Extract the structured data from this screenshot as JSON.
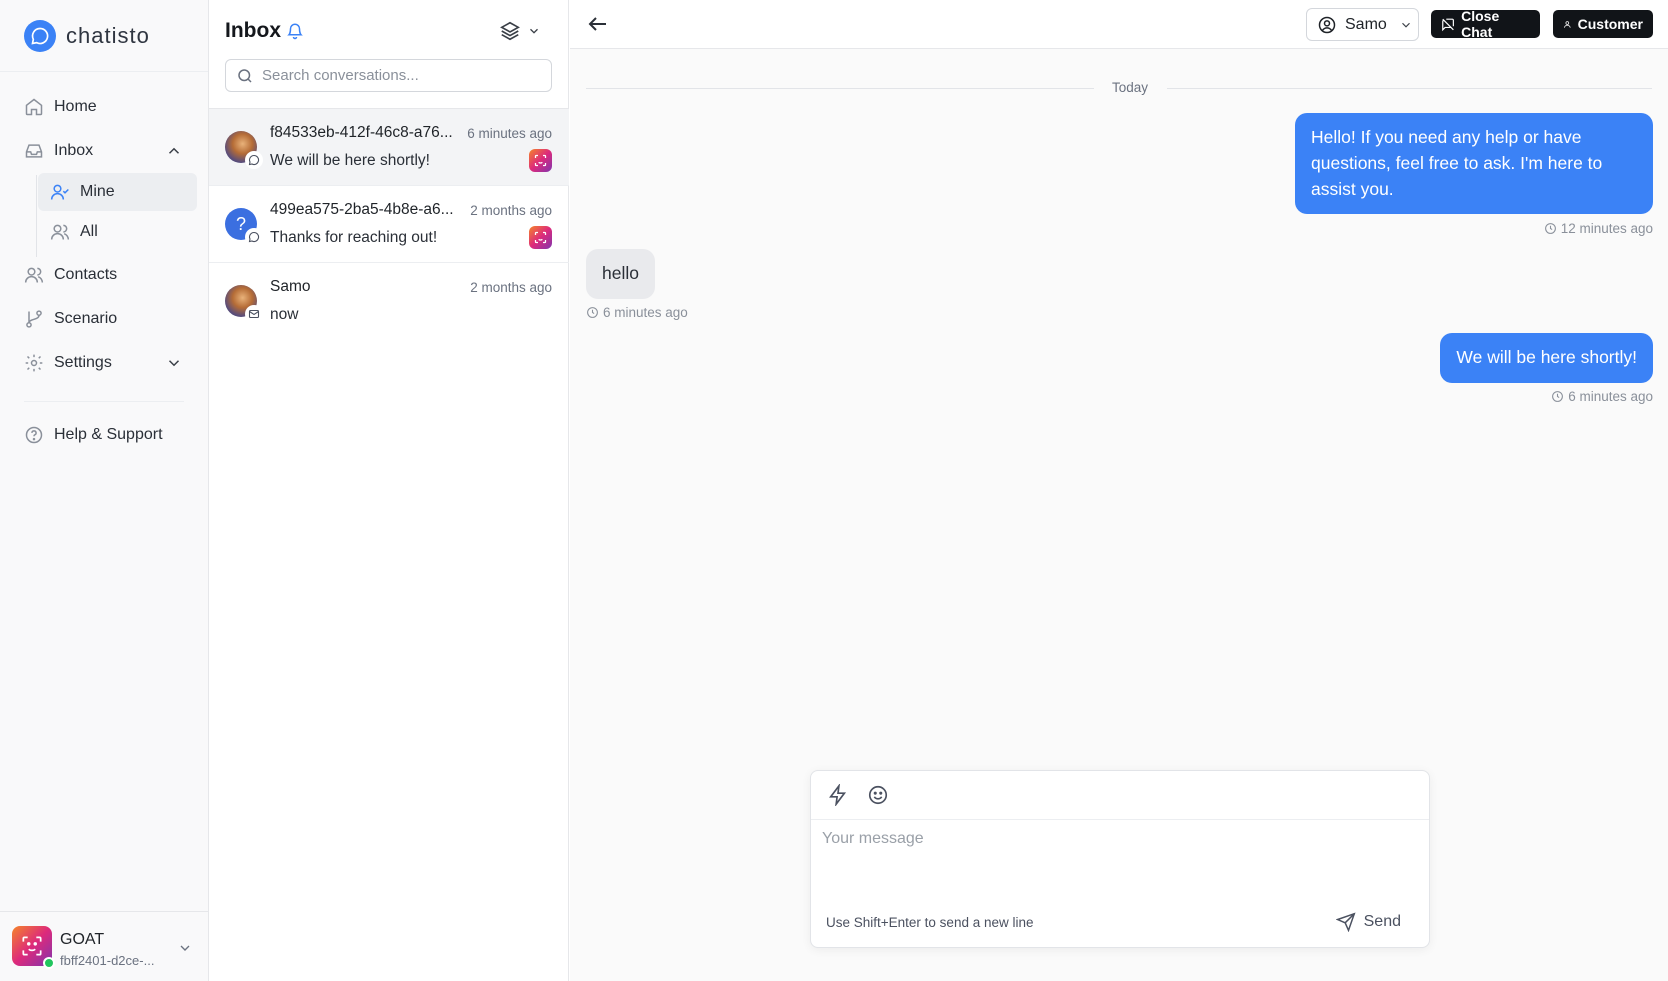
{
  "app": {
    "brand": "chatisto"
  },
  "sidebar": {
    "home": "Home",
    "inbox": "Inbox",
    "mine": "Mine",
    "all": "All",
    "contacts": "Contacts",
    "scenario": "Scenario",
    "settings": "Settings",
    "help": "Help & Support"
  },
  "account": {
    "name": "GOAT",
    "id": "fbff2401-d2ce-..."
  },
  "inbox": {
    "title": "Inbox",
    "search_placeholder": "Search conversations...",
    "conversations": [
      {
        "name": "f84533eb-412f-46c8-a76...",
        "time": "6 minutes ago",
        "message": "We will be here shortly!",
        "avatar": "photo",
        "channel": "chat-icon",
        "source": "instagram-icon"
      },
      {
        "name": "499ea575-2ba5-4b8e-a6...",
        "time": "2 months ago",
        "message": "Thanks for reaching out!",
        "avatar": "unknown",
        "channel": "chat-icon",
        "source": "instagram-icon"
      },
      {
        "name": "Samo",
        "time": "2 months ago",
        "message": "now",
        "avatar": "photo",
        "channel": "mail-icon"
      }
    ]
  },
  "chat": {
    "assignee": "Samo",
    "close_chat": "Close Chat",
    "customer": "Customer",
    "day_label": "Today",
    "messages": [
      {
        "direction": "outgoing",
        "text": "Hello! If you need any help or have questions, feel free to ask. I'm here to assist you.",
        "time": "12 minutes ago"
      },
      {
        "direction": "incoming",
        "text": "hello",
        "time": "6 minutes ago"
      },
      {
        "direction": "outgoing",
        "text": "We will be here shortly!",
        "time": "6 minutes ago"
      }
    ]
  },
  "composer": {
    "placeholder": "Your message",
    "hint": "Use Shift+Enter to send a new line",
    "send": "Send"
  },
  "colors": {
    "accent": "#3b82f6",
    "dark_button": "#111418",
    "online": "#22c55e"
  }
}
